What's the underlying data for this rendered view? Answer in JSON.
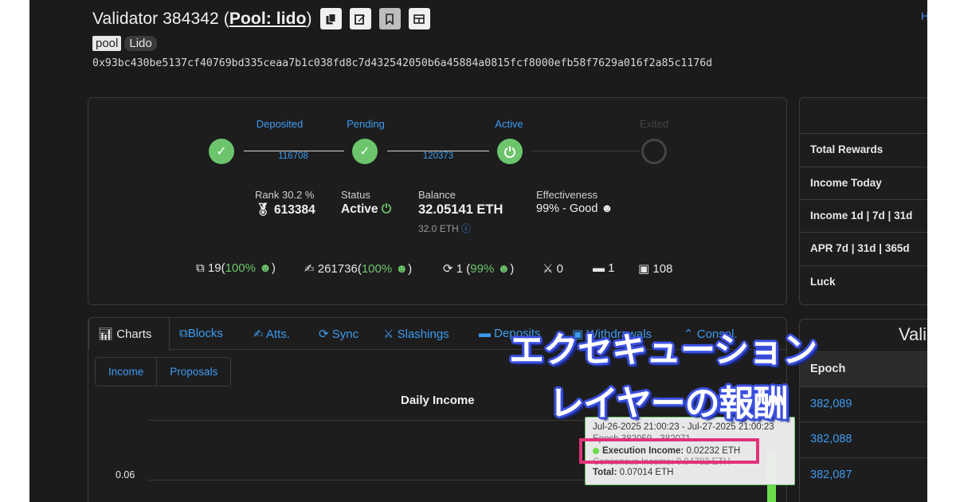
{
  "header": {
    "title_prefix": "Validator 384342 (",
    "pool_link": "Pool: lido",
    "title_suffix": ")",
    "right_link": "H",
    "tag_pool": "pool",
    "tag_lido": "Lido",
    "pubkey": "0x93bc430be5137cf40769bd335ceaa7b1c038fd8c7d432542050b6a45884a0815fcf8000efb58f7629a016f2a85c1176d",
    "icons": [
      "copy-icon",
      "edit-icon",
      "bookmark-icon",
      "table-icon"
    ]
  },
  "lifecycle": {
    "stages": [
      "Deposited",
      "Pending",
      "Active",
      "Exited"
    ],
    "epochs": [
      "116708",
      "120373"
    ]
  },
  "stats": {
    "rank_label": "Rank 30.2 %",
    "rank_value": "613384",
    "status_label": "Status",
    "status_value": "Active",
    "balance_label": "Balance",
    "balance_value": "32.05141 ETH",
    "balance_sub": "32.0 ETH",
    "effectiveness_label": "Effectiveness",
    "effectiveness_value": "99% - Good",
    "proposals_count": "19",
    "proposals_pct": "100%",
    "attestations_count": "261736",
    "attestations_pct": "100%",
    "sync_count": "1",
    "sync_pct": "99%",
    "slashings_count": "0",
    "deposits_count": "1",
    "withdrawals_count": "108"
  },
  "right_panel": {
    "rows": [
      "Total Rewards",
      "Income Today",
      "Income 1d | 7d | 31d",
      "APR 7d | 31d | 365d",
      "Luck"
    ],
    "table_title": "Vali",
    "table_head": "Epoch",
    "epochs": [
      "382,089",
      "382,088",
      "382,087"
    ]
  },
  "tabs": {
    "items": [
      "Charts",
      "Blocks",
      "Atts.",
      "Sync",
      "Slashings",
      "Deposits",
      "Withdrawals",
      "Consol."
    ],
    "subtabs": [
      "Income",
      "Proposals"
    ]
  },
  "chart": {
    "title": "Daily Income",
    "ytick": "0.06"
  },
  "tooltip": {
    "range": "Jul-26-2025 21:00:23 - Jul-27-2025 21:00:23",
    "epochs": "Epoch 382059 - 382071",
    "exec_label": "Execution Income:",
    "exec_value": "0.02232 ETH",
    "consensus": "Consensus Income: 0.04782 ETH",
    "total_label": "Total:",
    "total_value": "0.07014 ETH"
  },
  "caption": {
    "line1": "エクセキューション",
    "line2": "レイヤーの報酬"
  },
  "chart_data": {
    "type": "bar",
    "title": "Daily Income",
    "categories": [
      "Jul-26-2025"
    ],
    "series": [
      {
        "name": "Execution Income",
        "values": [
          0.02232
        ]
      },
      {
        "name": "Consensus Income",
        "values": [
          0.04782
        ]
      }
    ],
    "ylabel": "",
    "xlabel": "",
    "colors": {
      "accent": "#3d9bf0",
      "good": "#6cc56c",
      "bar": "#6cdc4a",
      "highlight": "#e0337a"
    }
  }
}
